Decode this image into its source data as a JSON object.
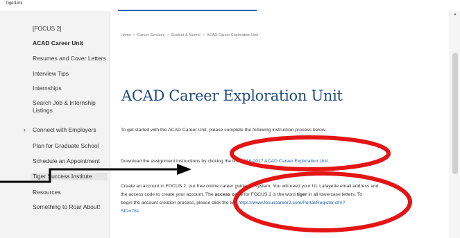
{
  "browser": {
    "tab_label": "TigerLink"
  },
  "sidebar": {
    "items": [
      {
        "label": "[FOCUS 2]"
      },
      {
        "label": "ACAD Career Unit"
      },
      {
        "label": "Resumes and Cover Letters"
      },
      {
        "label": "Interview Tips"
      },
      {
        "label": "Internships"
      },
      {
        "label": "Search Job & Internship Listings"
      },
      {
        "label": "Connect with Employers"
      },
      {
        "label": "Plan for Graduate School"
      },
      {
        "label": "Schedule an Appointment"
      },
      {
        "label": "Tiger Success Institute"
      },
      {
        "label": "Resources"
      },
      {
        "label": "Something to Roar About!"
      }
    ]
  },
  "breadcrumb": {
    "home": "Home",
    "career_services": "Career Services",
    "students": "Student & Alumni",
    "current": "ACAD Career Exploration Unit",
    "sep": ">"
  },
  "main": {
    "title": "ACAD Career Exploration Unit",
    "p1": "To get started with the ACAD Career Unit, please complete the following instruction process below.",
    "p2_prefix": "Download the assignment instructions by clicking the link ",
    "p2_link": "2016-2017 ACAD Career Exploration Unit.",
    "p3_a": "Create an account in FOCUS 2, our free online career guidance system. You will need your UL Lafayette email address and",
    "p3_b": "the access code to create your account. The ",
    "p3_b_bold": "access code",
    "p3_b2": " for FOCUS 2 is the word ",
    "p3_b_bold2": "tiger",
    "p3_b3": " in all lowercase letters. To",
    "p3_c": "begin the account creation process, please click the link ",
    "p3_link1": "https://www.focuscareer2.com/Portal/Register.cfm?",
    "p3_link2": "SID=781."
  },
  "colors": {
    "title": "#1f4a7e",
    "link": "#1f5fa8",
    "annotation": "#e41515"
  }
}
